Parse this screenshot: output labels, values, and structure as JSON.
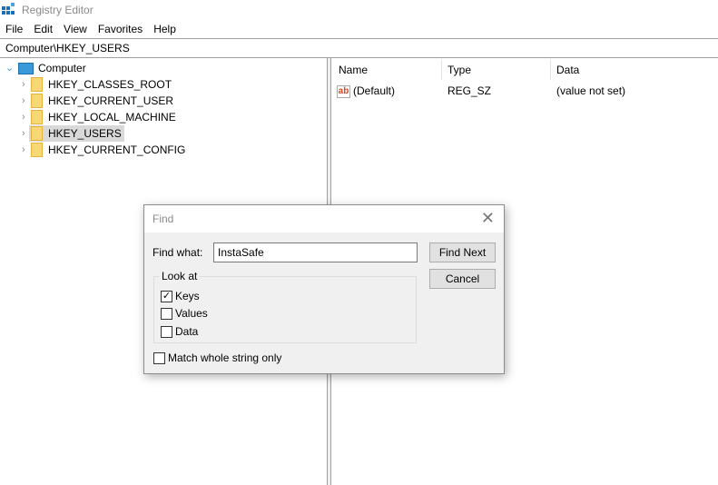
{
  "window": {
    "title": "Registry Editor"
  },
  "menu": [
    "File",
    "Edit",
    "View",
    "Favorites",
    "Help"
  ],
  "address": "Computer\\HKEY_USERS",
  "tree": {
    "root": "Computer",
    "items": [
      "HKEY_CLASSES_ROOT",
      "HKEY_CURRENT_USER",
      "HKEY_LOCAL_MACHINE",
      "HKEY_USERS",
      "HKEY_CURRENT_CONFIG"
    ],
    "selected": "HKEY_USERS"
  },
  "list": {
    "columns": [
      "Name",
      "Type",
      "Data"
    ],
    "rows": [
      {
        "name": "(Default)",
        "type": "REG_SZ",
        "data": "(value not set)",
        "icon": "string-value-icon"
      }
    ]
  },
  "find": {
    "title": "Find",
    "find_what_label": "Find what:",
    "find_what_value": "InstaSafe",
    "find_next": "Find Next",
    "cancel": "Cancel",
    "look_at": "Look at",
    "options": [
      {
        "label": "Keys",
        "checked": true
      },
      {
        "label": "Values",
        "checked": false
      },
      {
        "label": "Data",
        "checked": false
      }
    ],
    "match_whole": {
      "label": "Match whole string only",
      "checked": false
    }
  },
  "colors": {
    "selection": "#d9d9d9",
    "folder": "#f8d775",
    "accent": "#1e6fb8"
  }
}
